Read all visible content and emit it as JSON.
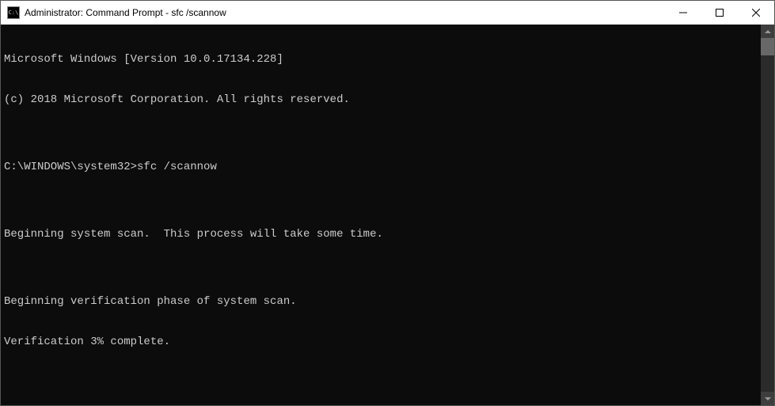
{
  "titlebar": {
    "icon_glyph": "C:\\",
    "title": "Administrator: Command Prompt - sfc  /scannow"
  },
  "terminal": {
    "lines": [
      "Microsoft Windows [Version 10.0.17134.228]",
      "(c) 2018 Microsoft Corporation. All rights reserved.",
      "",
      "C:\\WINDOWS\\system32>sfc /scannow",
      "",
      "Beginning system scan.  This process will take some time.",
      "",
      "Beginning verification phase of system scan.",
      "Verification 3% complete."
    ]
  }
}
